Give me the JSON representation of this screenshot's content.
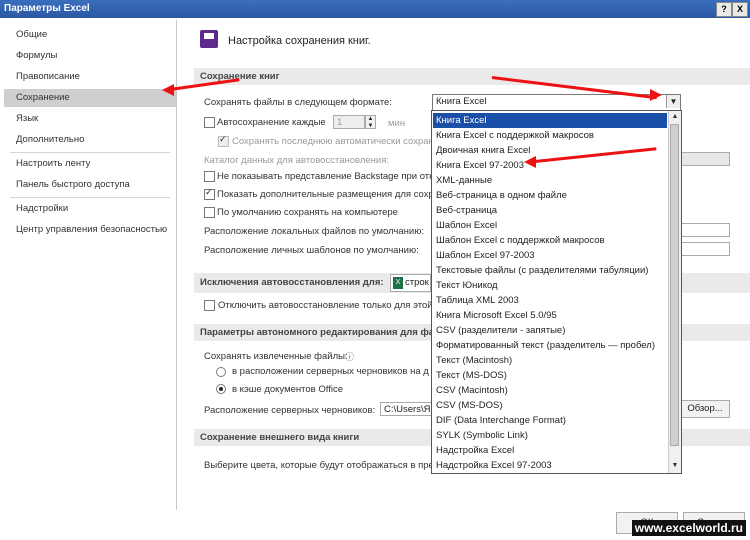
{
  "window": {
    "title": "Параметры Excel",
    "help": "?",
    "close": "X"
  },
  "sidebar": {
    "items": [
      {
        "label": "Общие"
      },
      {
        "label": "Формулы"
      },
      {
        "label": "Правописание"
      },
      {
        "label": "Сохранение"
      },
      {
        "label": "Язык"
      },
      {
        "label": "Дополнительно"
      },
      {
        "label": "Настроить ленту"
      },
      {
        "label": "Панель быстрого доступа"
      },
      {
        "label": "Надстройки"
      },
      {
        "label": "Центр управления безопасностью"
      }
    ],
    "selected": "Сохранение"
  },
  "header": {
    "title": "Настройка сохранения книг.",
    "icon": "save-disk-icon"
  },
  "sections": {
    "save_books": "Сохранение книг",
    "autorecover_exceptions": "Исключения автовосстановления для:",
    "offline_editing": "Параметры автономного редактирования для фай",
    "preserve_appearance": "Сохранение внешнего вида книги"
  },
  "save": {
    "format_label": "Сохранять файлы в следующем формате:",
    "format_value": "Книга Excel",
    "autosave_label": "Автосохранение каждые",
    "autosave_value": "1",
    "autosave_unit": "мин",
    "keep_last_label": "Сохранять последнюю автоматически сохраненную вер",
    "autorecover_catalog_label": "Каталог данных для автовосстановления:",
    "no_backstage_label": "Не показывать представление Backstage при отк",
    "show_additional_label": "Показать дополнительные размещения для сохр",
    "default_local_label": "По умолчанию сохранять на компьютере",
    "local_location_label": "Расположение локальных файлов по умолчанию:",
    "templates_location_label": "Расположение личных шаблонов по умолчанию:"
  },
  "exceptions": {
    "workbook_value": "строк",
    "disable_autorecover_label": "Отключить автовосстановление только для этой"
  },
  "offline": {
    "save_extracted_label": "Сохранять извлеченные файлы:",
    "server_drafts_option": "в расположении серверных черновиков на д",
    "office_cache_option": "в кэше документов Office",
    "server_drafts_location_label": "Расположение серверных черновиков:",
    "server_drafts_location_value": "C:\\Users\\Ян",
    "browse_label": "Обзор..."
  },
  "appearance": {
    "colors_label": "Выберите цвета, которые будут отображаться в пред"
  },
  "dropdown": {
    "options": [
      "Книга Excel",
      "Книга Excel с поддержкой макросов",
      "Двоичная книга Excel",
      "Книга Excel 97-2003",
      "XML-данные",
      "Веб-страница в одном файле",
      "Веб-страница",
      "Шаблон Excel",
      "Шаблон Excel с поддержкой макросов",
      "Шаблон Excel 97-2003",
      "Текстовые файлы (с разделителями табуляции)",
      "Текст Юникод",
      "Таблица XML 2003",
      "Книга Microsoft Excel 5.0/95",
      "CSV (разделители - запятые)",
      "Форматированный текст (разделитель — пробел)",
      "Текст (Macintosh)",
      "Текст (MS-DOS)",
      "CSV (Macintosh)",
      "CSV (MS-DOS)",
      "DIF (Data Interchange Format)",
      "SYLK (Symbolic Link)",
      "Надстройка Excel",
      "Надстройка Excel 97-2003"
    ],
    "selected_index": 0
  },
  "footer": {
    "ok": "ОК",
    "cancel": "Отмена"
  },
  "watermark": "www.excelworld.ru",
  "colors": {
    "title_bar": "#2a57a3",
    "selection": "#1a4fa8",
    "annotation": "#e11111"
  }
}
